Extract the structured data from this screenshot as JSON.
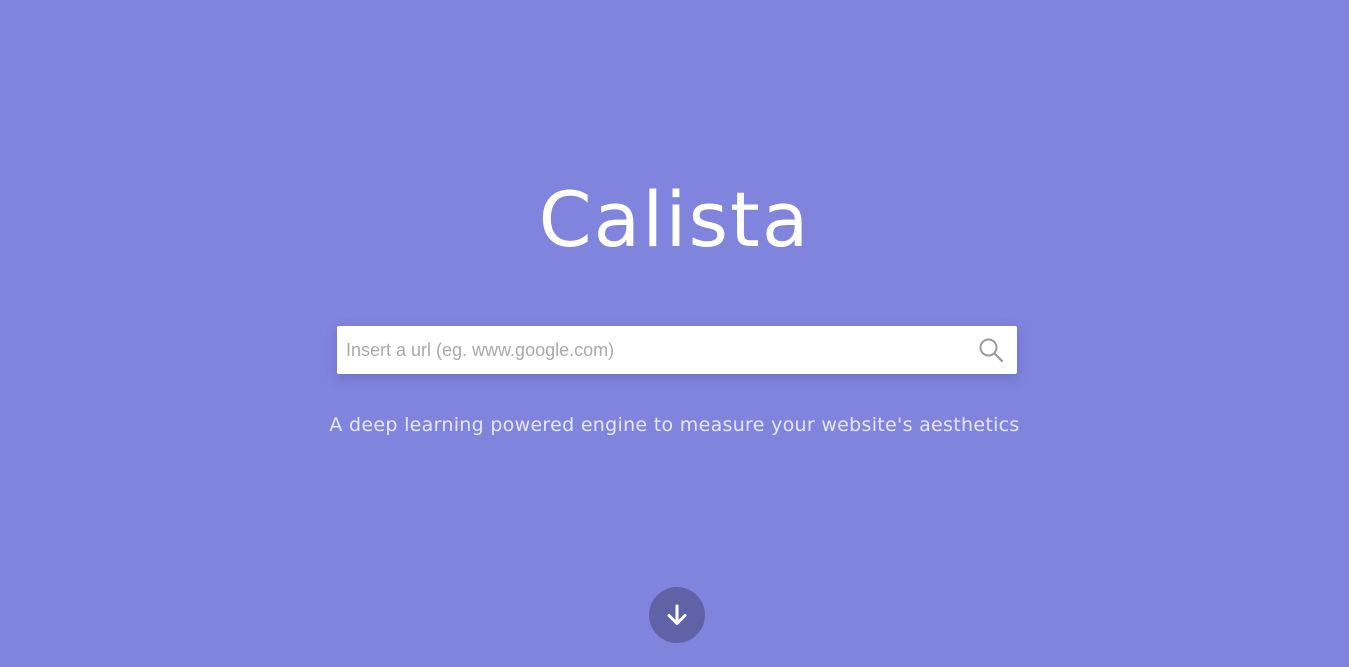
{
  "app": {
    "logo_text": "Calista"
  },
  "search": {
    "placeholder": "Insert a url (eg. www.google.com)",
    "value": "",
    "icon": "search-icon"
  },
  "tagline": "A deep learning powered engine to measure your website's aesthetics",
  "scroll": {
    "icon": "arrow-down-icon"
  },
  "colors": {
    "background": "#8084dd",
    "scroll_button": "#5f62a6",
    "logo": "#ffffff",
    "tagline": "#e6e7fa"
  }
}
